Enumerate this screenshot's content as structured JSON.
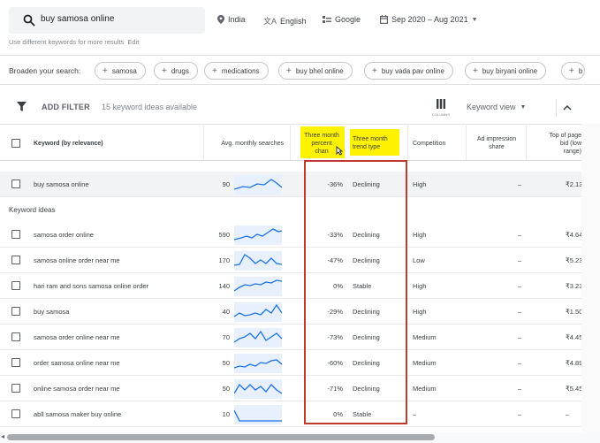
{
  "search": {
    "query": "buy samosa online",
    "location": "India",
    "language": "English",
    "network": "Google",
    "date_range": "Sep 2020 – Aug 2021",
    "hint": "Use different keywords for more results",
    "edit": "Edit"
  },
  "broaden": {
    "label": "Broaden your search:",
    "chips": [
      "samosa",
      "drugs",
      "medications",
      "buy bhel online",
      "buy vada pav online",
      "buy biryani online",
      "b"
    ]
  },
  "toolbar": {
    "add_filter": "ADD FILTER",
    "ideas_count": "15 keyword ideas available",
    "columns_label": "COLUMNS",
    "view": "Keyword view"
  },
  "columns": {
    "keyword": "Keyword (by relevance)",
    "avg": "Avg. monthly searches",
    "three_month_change": [
      "Three month",
      "percent",
      "chan"
    ],
    "three_month_trend": [
      "Three month",
      "trend type"
    ],
    "competition": "Competition",
    "impression_share": [
      "Ad impression",
      "share"
    ],
    "top_bid": [
      "Top of page",
      "bid (low",
      "range)"
    ]
  },
  "section_label": "Keyword ideas",
  "rows": [
    {
      "keyword": "buy samosa online",
      "avg": "90",
      "change": "-36%",
      "trend": "Declining",
      "competition": "High",
      "impression": "–",
      "bid": "₹2.13"
    },
    {
      "keyword": "samosa order online",
      "avg": "590",
      "change": "-33%",
      "trend": "Declining",
      "competition": "High",
      "impression": "–",
      "bid": "₹4.64"
    },
    {
      "keyword": "samosa online order near me",
      "avg": "170",
      "change": "-47%",
      "trend": "Declining",
      "competition": "Low",
      "impression": "–",
      "bid": "₹5.23"
    },
    {
      "keyword": "hari ram and sons samosa online order",
      "avg": "140",
      "change": "0%",
      "trend": "Stable",
      "competition": "High",
      "impression": "–",
      "bid": "₹3.23"
    },
    {
      "keyword": "buy samosa",
      "avg": "40",
      "change": "-29%",
      "trend": "Declining",
      "competition": "High",
      "impression": "–",
      "bid": "₹1.50"
    },
    {
      "keyword": "samosa order online near me",
      "avg": "70",
      "change": "-73%",
      "trend": "Declining",
      "competition": "Medium",
      "impression": "–",
      "bid": "₹4.45"
    },
    {
      "keyword": "order samosa online near me",
      "avg": "50",
      "change": "-60%",
      "trend": "Declining",
      "competition": "Medium",
      "impression": "–",
      "bid": "₹4.89"
    },
    {
      "keyword": "online samosa order near me",
      "avg": "50",
      "change": "-71%",
      "trend": "Declining",
      "competition": "Medium",
      "impression": "–",
      "bid": "₹5.45"
    },
    {
      "keyword": "abll samosa maker buy online",
      "avg": "10",
      "change": "0%",
      "trend": "Stable",
      "competition": "–",
      "impression": "–",
      "bid": "–"
    }
  ],
  "colors": {
    "highlight": "#fff200",
    "annotation_box": "#c0392b",
    "spark_line": "#1a73e8",
    "spark_bg": "#e8f0fe"
  }
}
